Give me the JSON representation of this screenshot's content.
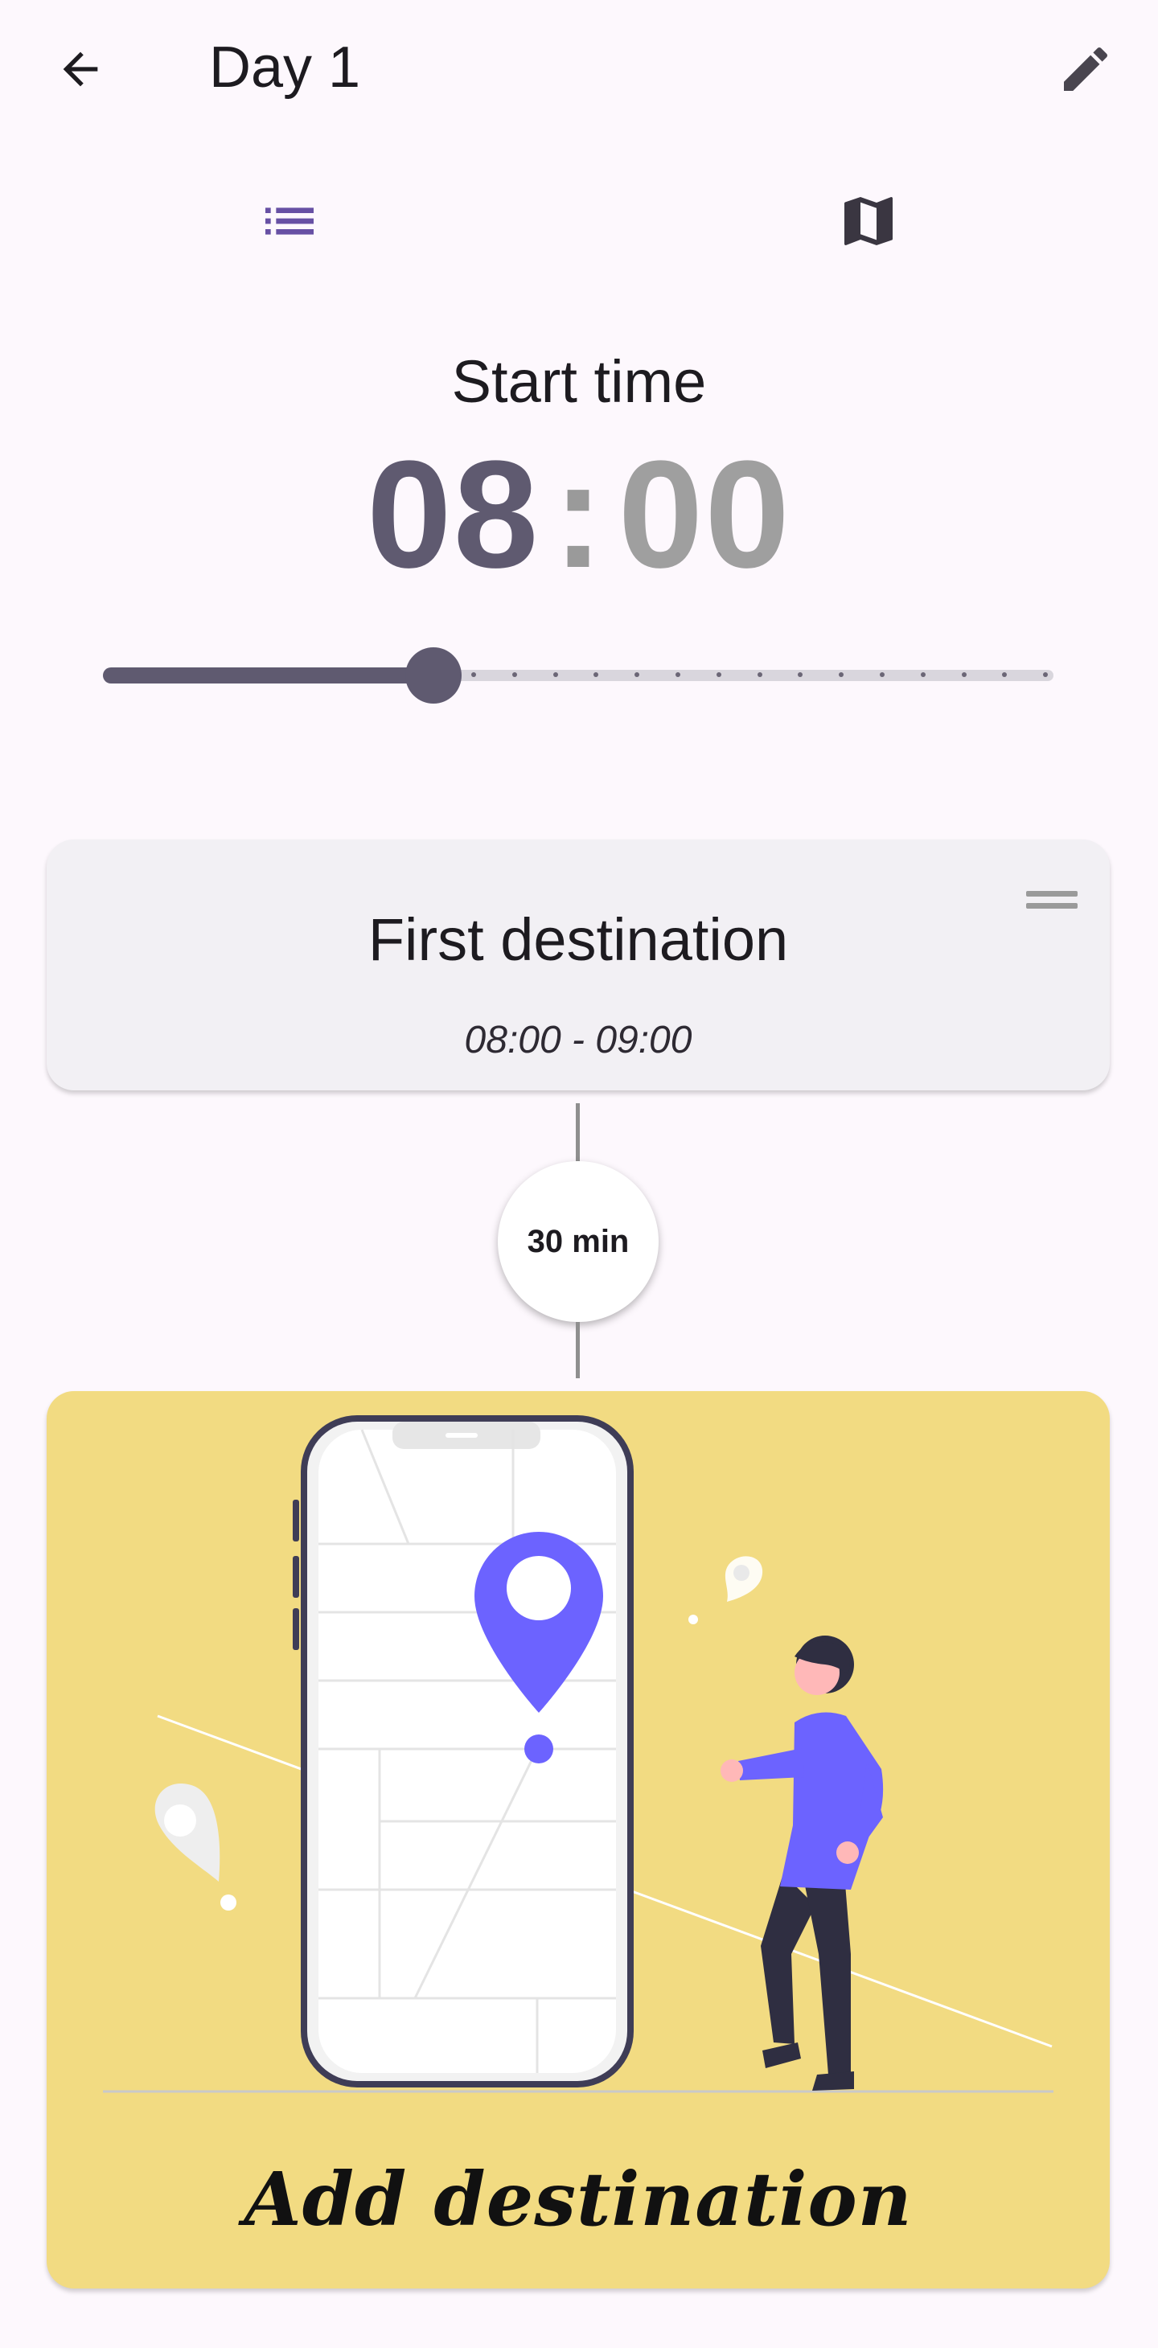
{
  "appbar": {
    "title": "Day 1",
    "back_icon": "arrow-back-icon",
    "edit_icon": "pencil-icon"
  },
  "tabs": [
    {
      "icon": "list-icon",
      "selected": true
    },
    {
      "icon": "map-icon",
      "selected": false
    }
  ],
  "start_time": {
    "label": "Start time",
    "hours": "08",
    "separator": ":",
    "minutes": "00",
    "slider_fraction": 0.348,
    "slider_steps": 14
  },
  "destinations": [
    {
      "name": "First destination",
      "time_range": "08:00 - 09:00"
    }
  ],
  "travel": {
    "duration": "30 min"
  },
  "add_card": {
    "label": "Add destination"
  },
  "colors": {
    "accent": "#5f5a70",
    "tab_selected": "#6750a4",
    "card_bg": "#f2f0f4",
    "add_card_bg": "#f2db82",
    "pin": "#6c63ff"
  }
}
